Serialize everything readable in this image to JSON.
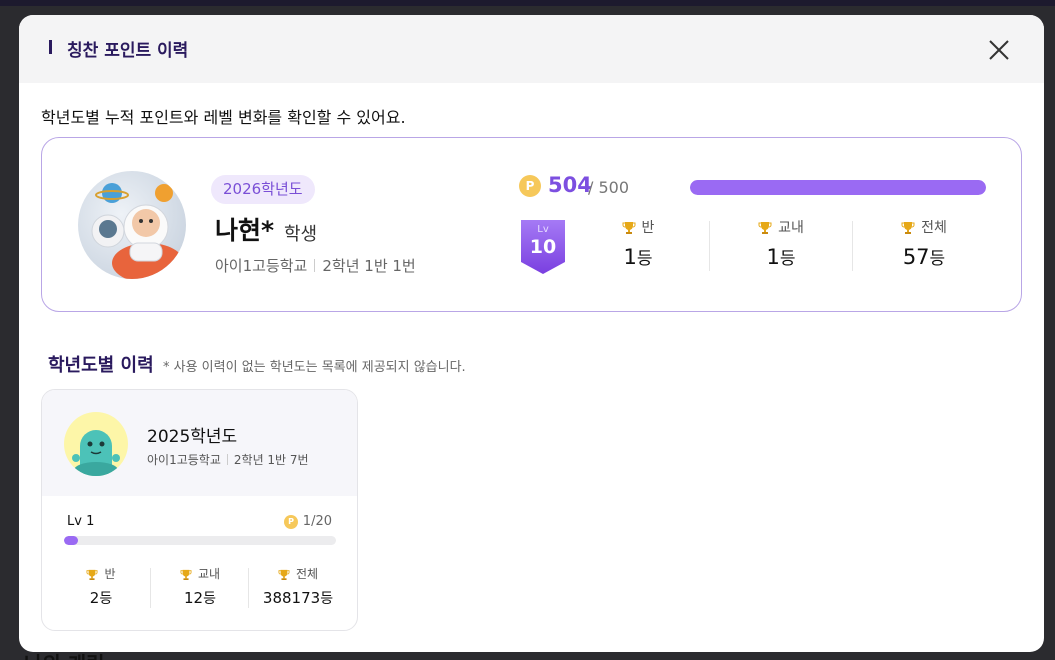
{
  "background": {
    "peek_text": "나의 캐릭"
  },
  "modal": {
    "title": "칭찬 포인트 이력",
    "close_icon": "close-icon",
    "description": "학년도별 누적 포인트와 레벨 변화를 확인할 수 있어요."
  },
  "profile": {
    "year_badge": "2026학년도",
    "name": "나현*",
    "role": "학생",
    "school": "아이1고등학교",
    "class_info": "2학년 1반 1번",
    "points_current": "504",
    "points_max": "/ 500",
    "progress_fraction": 1.0,
    "coin_label": "P",
    "level_label": "Lv",
    "level": "10",
    "ranks": [
      {
        "label": "반",
        "value": "1",
        "unit": "등"
      },
      {
        "label": "교내",
        "value": "1",
        "unit": "등"
      },
      {
        "label": "전체",
        "value": "57",
        "unit": "등"
      }
    ]
  },
  "history": {
    "title": "학년도별 이력",
    "note": "* 사용 이력이 없는 학년도는 목록에 제공되지 않습니다.",
    "cards": [
      {
        "year": "2025학년도",
        "school": "아이1고등학교",
        "class_info": "2학년 1반 7번",
        "level": "Lv 1",
        "coin_label": "P",
        "points": "1/20",
        "progress_fraction": 0.05,
        "ranks": [
          {
            "label": "반",
            "value": "2",
            "unit": "등"
          },
          {
            "label": "교내",
            "value": "12",
            "unit": "등"
          },
          {
            "label": "전체",
            "value": "388173",
            "unit": "등"
          }
        ]
      }
    ]
  },
  "colors": {
    "accent": "#9a6af3",
    "title": "#2a1a5e",
    "coin": "#f6c85a",
    "trophy": "#e6a817"
  }
}
